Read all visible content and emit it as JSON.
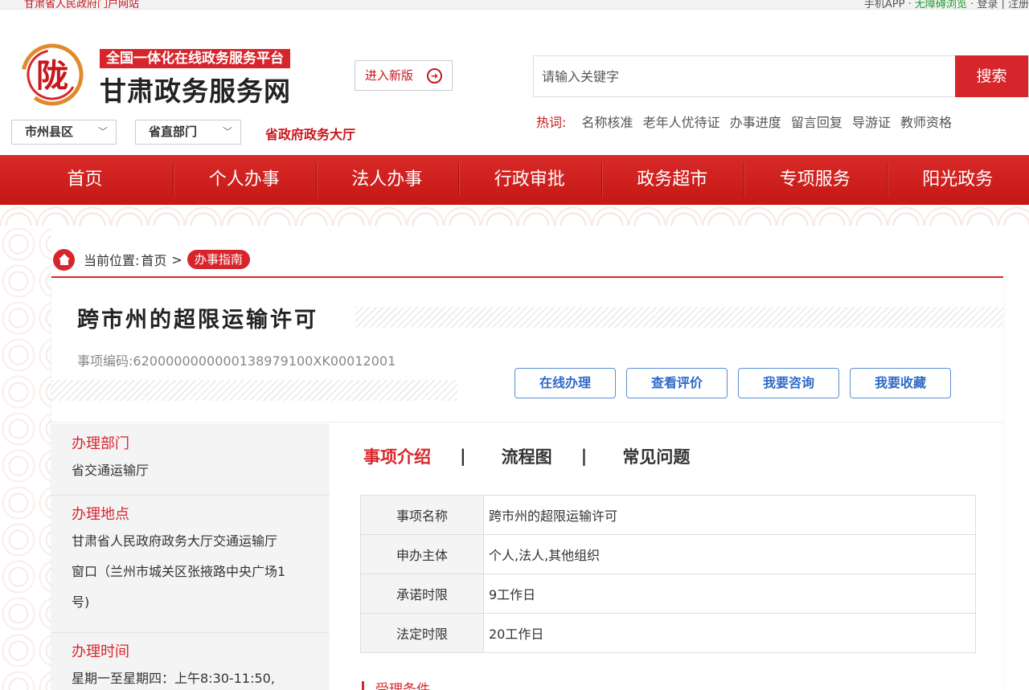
{
  "topbar": {
    "left_red": "甘肃省人民政府门户网站",
    "right_links": [
      "手机APP",
      "无障碍浏览",
      "登录",
      "注册"
    ]
  },
  "header": {
    "platform_tag": "全国一体化在线政务服务平台",
    "site_name": "甘肃政务服务网",
    "new_version": "进入新版",
    "dropdown_city": "市州县区",
    "dropdown_dept": "省直部门",
    "hall_link": "省政府政务大厅",
    "search_placeholder": "请输入关键字",
    "search_button": "搜索",
    "hotwords_label": "热词:",
    "hotwords": [
      "名称核准",
      "老年人优待证",
      "办事进度",
      "留言回复",
      "导游证",
      "教师资格"
    ]
  },
  "nav": [
    "首页",
    "个人办事",
    "法人办事",
    "行政审批",
    "政务超市",
    "专项服务",
    "阳光政务"
  ],
  "breadcrumb": {
    "prefix": "当前位置:",
    "home": "首页",
    "arrow": ">",
    "current": "办事指南"
  },
  "item": {
    "title": "跨市州的超限运输许可",
    "code_label": "事项编码:",
    "code": "620000000000013897910 0XK00012001",
    "code_display": "6200000000000138979100XK00012001",
    "actions": [
      "在线办理",
      "查看评价",
      "我要咨询",
      "我要收藏"
    ]
  },
  "sidebar": {
    "dept_label": "办理部门",
    "dept": "省交通运输厅",
    "place_label": "办理地点",
    "place_lines": [
      "甘肃省人民政府政务大厅交通运输厅",
      "窗口（兰州市城关区张掖路中央广场1",
      "号)"
    ],
    "time_label": "办理时间",
    "time": "星期一至星期四：上午8:30-11:50,"
  },
  "tabs": [
    "事项介绍",
    "流程图",
    "常见问题"
  ],
  "tab_sep": "|",
  "info_table": [
    {
      "key": "事项名称",
      "value": "跨市州的超限运输许可"
    },
    {
      "key": "申办主体",
      "value": "个人,法人,其他组织"
    },
    {
      "key": "承诺时限",
      "value": "9工作日"
    },
    {
      "key": "法定时限",
      "value": "20工作日"
    }
  ],
  "section_next": "受理条件",
  "colors": {
    "brand_red": "#d7262b",
    "action_blue": "#2f6ac8"
  }
}
